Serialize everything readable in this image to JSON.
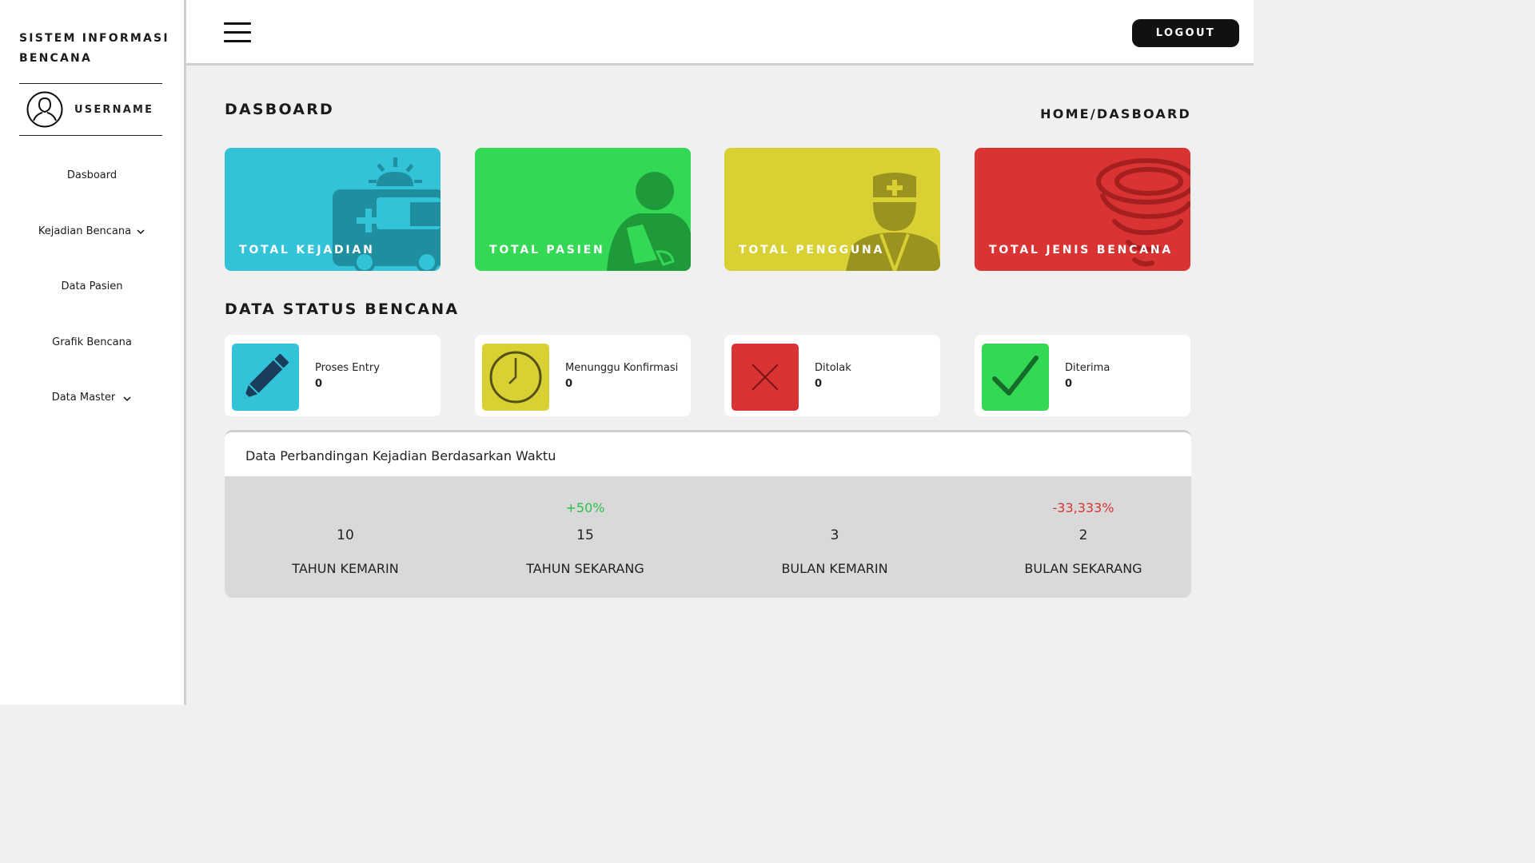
{
  "app": {
    "title": "SISTEM INFORMASI BENCANA"
  },
  "user": {
    "name": "USERNAME",
    "avatar_icon": "user-outline-icon"
  },
  "nav": [
    {
      "label": "Dasboard",
      "has_submenu": false
    },
    {
      "label": "Kejadian Bencana",
      "has_submenu": true
    },
    {
      "label": "Data Pasien",
      "has_submenu": false
    },
    {
      "label": "Grafik Bencana",
      "has_submenu": false
    },
    {
      "label": "Data Master",
      "has_submenu": true
    }
  ],
  "topbar": {
    "menu_icon": "hamburger-icon",
    "logout_label": "LOGOUT"
  },
  "page": {
    "title": "DASBOARD",
    "breadcrumb": "HOME/DASBOARD"
  },
  "stats": [
    {
      "label": "TOTAL KEJADIAN",
      "color": "#33c3d9",
      "icon": "ambulance-icon"
    },
    {
      "label": "TOTAL PASIEN",
      "color": "#33d955",
      "icon": "patient-icon"
    },
    {
      "label": "TOTAL PENGGUNA",
      "color": "#d9d133",
      "icon": "medic-icon"
    },
    {
      "label": "TOTAL JENIS BENCANA",
      "color": "#d93333",
      "icon": "tornado-icon"
    }
  ],
  "status_section": {
    "title": "DATA STATUS BENCANA"
  },
  "status": [
    {
      "name": "Proses Entry",
      "count": "0",
      "color": "#33c3d9",
      "icon": "pencil-icon"
    },
    {
      "name": "Menunggu Konfirmasi",
      "count": "0",
      "color": "#d9d133",
      "icon": "clock-icon"
    },
    {
      "name": "Ditolak",
      "count": "0",
      "color": "#d93333",
      "icon": "x-mark-icon"
    },
    {
      "name": "Diterima",
      "count": "0",
      "color": "#33d955",
      "icon": "check-icon"
    }
  ],
  "comparison": {
    "title": "Data Perbandingan Kejadian Berdasarkan Waktu",
    "columns": [
      {
        "label": "TAHUN KEMARIN",
        "value": "10",
        "change": ""
      },
      {
        "label": "TAHUN SEKARANG",
        "value": "15",
        "change": "+50%"
      },
      {
        "label": "BULAN KEMARIN",
        "value": "3",
        "change": ""
      },
      {
        "label": "BULAN SEKARANG",
        "value": "2",
        "change": "-33,333%"
      }
    ],
    "colors": {
      "up": "#2bbf4a",
      "down": "#d93333"
    }
  }
}
